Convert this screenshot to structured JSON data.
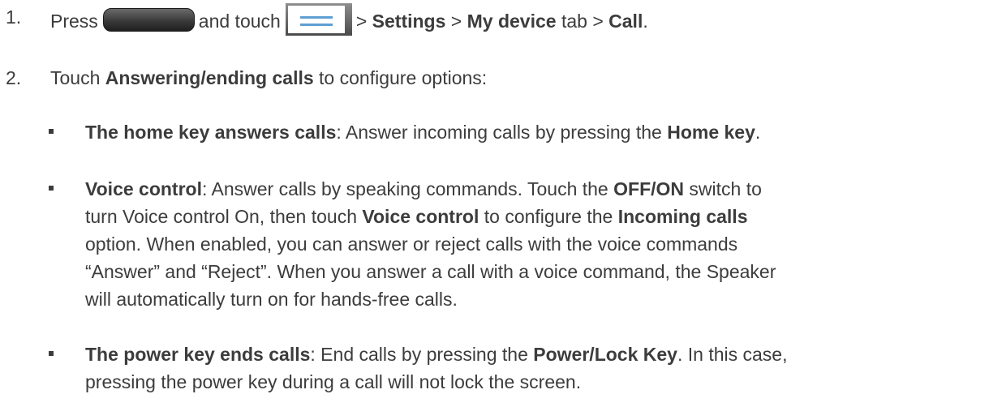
{
  "step1": {
    "number": "1.",
    "icons": {
      "home": "home-key-icon",
      "menu": "menu-key-icon"
    },
    "press": "Press",
    "and_touch": "and touch",
    "sep1": ">",
    "settings": "Settings",
    "sep2": ">",
    "my_device": "My device",
    "tab": "tab",
    "sep3": ">",
    "call": "Call",
    "end": "."
  },
  "step2": {
    "number": "2.",
    "touch": "Touch",
    "answering": "Answering/ending calls",
    "rest": "to configure options:"
  },
  "bullets": {
    "home_key": {
      "title": "The home key answers calls",
      "text1": ": Answer incoming calls by pressing the",
      "key": "Home key",
      "end": "."
    },
    "voice": {
      "title": "Voice control",
      "text1": ": Answer calls by speaking commands. Touch the",
      "offon": "OFF/ON",
      "text2": "switch to",
      "text3": "turn Voice control On, then touch",
      "vc": "Voice control",
      "text4": "to configure the",
      "incoming": "Incoming calls",
      "line3": "option. When enabled, you can answer or reject calls with the voice commands",
      "line4": "“Answer” and “Reject”. When you answer a call with a voice command, the Speaker",
      "line5": "will automatically turn on for hands-free calls."
    },
    "power": {
      "title": "The power key ends calls",
      "text1": ": End calls by pressing the",
      "key": "Power/Lock Key",
      "text2": ". In this case,",
      "line2": "pressing the power key during a call will not lock the screen."
    }
  }
}
